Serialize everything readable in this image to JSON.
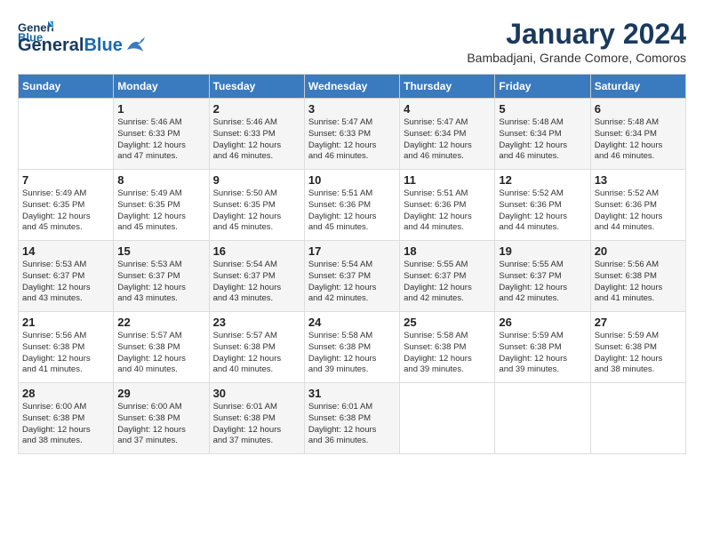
{
  "header": {
    "logo_line1": "General",
    "logo_line2": "Blue",
    "month": "January 2024",
    "location": "Bambadjani, Grande Comore, Comoros"
  },
  "weekdays": [
    "Sunday",
    "Monday",
    "Tuesday",
    "Wednesday",
    "Thursday",
    "Friday",
    "Saturday"
  ],
  "weeks": [
    [
      {
        "day": "",
        "info": ""
      },
      {
        "day": "1",
        "info": "Sunrise: 5:46 AM\nSunset: 6:33 PM\nDaylight: 12 hours\nand 47 minutes."
      },
      {
        "day": "2",
        "info": "Sunrise: 5:46 AM\nSunset: 6:33 PM\nDaylight: 12 hours\nand 46 minutes."
      },
      {
        "day": "3",
        "info": "Sunrise: 5:47 AM\nSunset: 6:33 PM\nDaylight: 12 hours\nand 46 minutes."
      },
      {
        "day": "4",
        "info": "Sunrise: 5:47 AM\nSunset: 6:34 PM\nDaylight: 12 hours\nand 46 minutes."
      },
      {
        "day": "5",
        "info": "Sunrise: 5:48 AM\nSunset: 6:34 PM\nDaylight: 12 hours\nand 46 minutes."
      },
      {
        "day": "6",
        "info": "Sunrise: 5:48 AM\nSunset: 6:34 PM\nDaylight: 12 hours\nand 46 minutes."
      }
    ],
    [
      {
        "day": "7",
        "info": "Sunrise: 5:49 AM\nSunset: 6:35 PM\nDaylight: 12 hours\nand 45 minutes."
      },
      {
        "day": "8",
        "info": "Sunrise: 5:49 AM\nSunset: 6:35 PM\nDaylight: 12 hours\nand 45 minutes."
      },
      {
        "day": "9",
        "info": "Sunrise: 5:50 AM\nSunset: 6:35 PM\nDaylight: 12 hours\nand 45 minutes."
      },
      {
        "day": "10",
        "info": "Sunrise: 5:51 AM\nSunset: 6:36 PM\nDaylight: 12 hours\nand 45 minutes."
      },
      {
        "day": "11",
        "info": "Sunrise: 5:51 AM\nSunset: 6:36 PM\nDaylight: 12 hours\nand 44 minutes."
      },
      {
        "day": "12",
        "info": "Sunrise: 5:52 AM\nSunset: 6:36 PM\nDaylight: 12 hours\nand 44 minutes."
      },
      {
        "day": "13",
        "info": "Sunrise: 5:52 AM\nSunset: 6:36 PM\nDaylight: 12 hours\nand 44 minutes."
      }
    ],
    [
      {
        "day": "14",
        "info": "Sunrise: 5:53 AM\nSunset: 6:37 PM\nDaylight: 12 hours\nand 43 minutes."
      },
      {
        "day": "15",
        "info": "Sunrise: 5:53 AM\nSunset: 6:37 PM\nDaylight: 12 hours\nand 43 minutes."
      },
      {
        "day": "16",
        "info": "Sunrise: 5:54 AM\nSunset: 6:37 PM\nDaylight: 12 hours\nand 43 minutes."
      },
      {
        "day": "17",
        "info": "Sunrise: 5:54 AM\nSunset: 6:37 PM\nDaylight: 12 hours\nand 42 minutes."
      },
      {
        "day": "18",
        "info": "Sunrise: 5:55 AM\nSunset: 6:37 PM\nDaylight: 12 hours\nand 42 minutes."
      },
      {
        "day": "19",
        "info": "Sunrise: 5:55 AM\nSunset: 6:37 PM\nDaylight: 12 hours\nand 42 minutes."
      },
      {
        "day": "20",
        "info": "Sunrise: 5:56 AM\nSunset: 6:38 PM\nDaylight: 12 hours\nand 41 minutes."
      }
    ],
    [
      {
        "day": "21",
        "info": "Sunrise: 5:56 AM\nSunset: 6:38 PM\nDaylight: 12 hours\nand 41 minutes."
      },
      {
        "day": "22",
        "info": "Sunrise: 5:57 AM\nSunset: 6:38 PM\nDaylight: 12 hours\nand 40 minutes."
      },
      {
        "day": "23",
        "info": "Sunrise: 5:57 AM\nSunset: 6:38 PM\nDaylight: 12 hours\nand 40 minutes."
      },
      {
        "day": "24",
        "info": "Sunrise: 5:58 AM\nSunset: 6:38 PM\nDaylight: 12 hours\nand 39 minutes."
      },
      {
        "day": "25",
        "info": "Sunrise: 5:58 AM\nSunset: 6:38 PM\nDaylight: 12 hours\nand 39 minutes."
      },
      {
        "day": "26",
        "info": "Sunrise: 5:59 AM\nSunset: 6:38 PM\nDaylight: 12 hours\nand 39 minutes."
      },
      {
        "day": "27",
        "info": "Sunrise: 5:59 AM\nSunset: 6:38 PM\nDaylight: 12 hours\nand 38 minutes."
      }
    ],
    [
      {
        "day": "28",
        "info": "Sunrise: 6:00 AM\nSunset: 6:38 PM\nDaylight: 12 hours\nand 38 minutes."
      },
      {
        "day": "29",
        "info": "Sunrise: 6:00 AM\nSunset: 6:38 PM\nDaylight: 12 hours\nand 37 minutes."
      },
      {
        "day": "30",
        "info": "Sunrise: 6:01 AM\nSunset: 6:38 PM\nDaylight: 12 hours\nand 37 minutes."
      },
      {
        "day": "31",
        "info": "Sunrise: 6:01 AM\nSunset: 6:38 PM\nDaylight: 12 hours\nand 36 minutes."
      },
      {
        "day": "",
        "info": ""
      },
      {
        "day": "",
        "info": ""
      },
      {
        "day": "",
        "info": ""
      }
    ]
  ]
}
